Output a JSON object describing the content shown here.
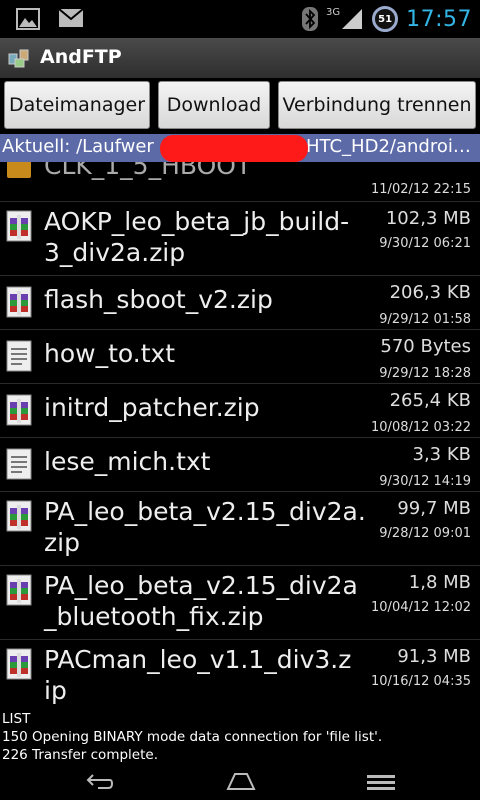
{
  "status": {
    "network": "3G",
    "battery": "51",
    "time": "17:57",
    "icons": [
      "image-icon",
      "mail-icon",
      "bluetooth-icon",
      "signal-icon",
      "battery-icon"
    ]
  },
  "app": {
    "title": "AndFTP"
  },
  "toolbar": {
    "file_manager_label": "Dateimanager",
    "download_label": "Download",
    "disconnect_label": "Verbindung trennen"
  },
  "path": {
    "prefix": "Aktuell: /Laufwer",
    "suffix": "HTC_HD2/androi…"
  },
  "partial_row": {
    "name": "CLK_1_5_HBOOT",
    "date": "11/02/12 22:15"
  },
  "files": [
    {
      "name": "AOKP_leo_beta_jb_build-\n3_div2a.zip",
      "size": "102,3 MB",
      "date": "9/30/12 06:21",
      "icon": "zip-icon"
    },
    {
      "name": "flash_sboot_v2.zip",
      "size": "206,3 KB",
      "date": "9/29/12 01:58",
      "icon": "zip-icon"
    },
    {
      "name": "how_to.txt",
      "size": "570 Bytes",
      "date": "9/29/12 18:28",
      "icon": "text-file-icon"
    },
    {
      "name": "initrd_patcher.zip",
      "size": "265,4 KB",
      "date": "10/08/12 03:22",
      "icon": "zip-icon"
    },
    {
      "name": "lese_mich.txt",
      "size": "3,3 KB",
      "date": "9/30/12 14:19",
      "icon": "text-file-icon"
    },
    {
      "name": "PA_leo_beta_v2.15_div2a.\nzip",
      "size": "99,7 MB",
      "date": "9/28/12 09:01",
      "icon": "zip-icon"
    },
    {
      "name": "PA_leo_beta_v2.15_div2a\n_bluetooth_fix.zip",
      "size": "1,8 MB",
      "date": "10/04/12 12:02",
      "icon": "zip-icon"
    },
    {
      "name": "PACman_leo_v1.1_div3.z\nip",
      "size": "91,3 MB",
      "date": "10/16/12 04:35",
      "icon": "zip-icon"
    }
  ],
  "log": [
    "LIST",
    "150 Opening BINARY mode data connection for 'file list'.",
    "226 Transfer complete."
  ],
  "nav": {
    "icons": [
      "back-icon",
      "home-icon",
      "recent-apps-icon"
    ]
  }
}
